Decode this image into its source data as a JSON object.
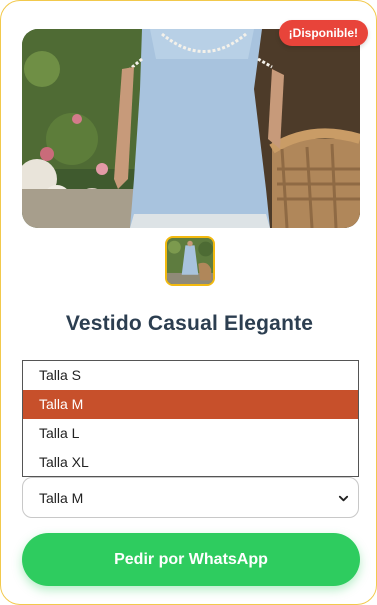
{
  "badge": {
    "label": "¡Disponible!"
  },
  "product": {
    "title": "Vestido Casual Elegante"
  },
  "size_dropdown": {
    "options": [
      "Talla S",
      "Talla M",
      "Talla L",
      "Talla XL"
    ],
    "selected": "Talla M"
  },
  "whatsapp_button": {
    "label": "Pedir por WhatsApp"
  },
  "colors": {
    "badge": "#e8443a",
    "accent_border": "#f2c94c",
    "selected_option": "#c7502b",
    "whatsapp": "#2ecc5f",
    "title": "#2c3e50"
  }
}
